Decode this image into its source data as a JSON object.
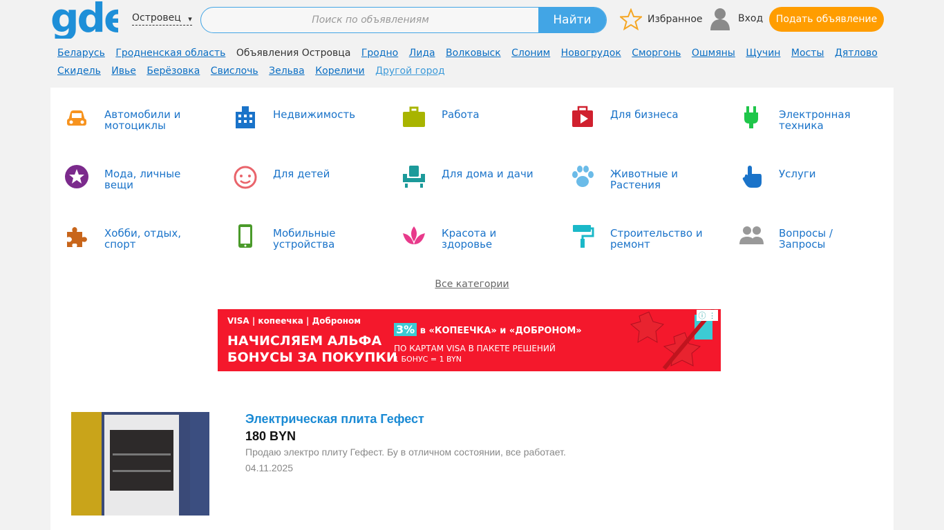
{
  "header": {
    "logo_text": "gde",
    "city": "Островец",
    "search_placeholder": "Поиск по объявлениям",
    "search_button": "Найти",
    "favorites": "Избранное",
    "login": "Вход",
    "post_ad": "Подать объявление"
  },
  "cities": [
    {
      "label": "Беларусь",
      "kind": "link"
    },
    {
      "label": "Гродненская область",
      "kind": "link"
    },
    {
      "label": "Объявления Островца",
      "kind": "current"
    },
    {
      "label": "Гродно",
      "kind": "link"
    },
    {
      "label": "Лида",
      "kind": "link"
    },
    {
      "label": "Волковыск",
      "kind": "link"
    },
    {
      "label": "Слоним",
      "kind": "link"
    },
    {
      "label": "Новогрудок",
      "kind": "link"
    },
    {
      "label": "Сморгонь",
      "kind": "link"
    },
    {
      "label": "Ошмяны",
      "kind": "link"
    },
    {
      "label": "Щучин",
      "kind": "link"
    },
    {
      "label": "Мосты",
      "kind": "link"
    },
    {
      "label": "Дятлово",
      "kind": "link"
    },
    {
      "label": "Скидель",
      "kind": "link"
    },
    {
      "label": "Ивье",
      "kind": "link"
    },
    {
      "label": "Берёзовка",
      "kind": "link"
    },
    {
      "label": "Свислочь",
      "kind": "link"
    },
    {
      "label": "Зельва",
      "kind": "link"
    },
    {
      "label": "Кореличи",
      "kind": "link"
    },
    {
      "label": "Другой город",
      "kind": "other"
    }
  ],
  "categories": [
    {
      "label": "Автомобили и мотоциклы",
      "icon": "car-icon",
      "color": "#f7931e"
    },
    {
      "label": "Недвижимость",
      "icon": "building-icon",
      "color": "#1a73c9"
    },
    {
      "label": "Работа",
      "icon": "briefcase-icon",
      "color": "#a8b400"
    },
    {
      "label": "Для бизнеса",
      "icon": "video-play-icon",
      "color": "#d0202e"
    },
    {
      "label": "Электронная техника",
      "icon": "plug-icon",
      "color": "#1fc64a"
    },
    {
      "label": "Мода, личные вещи",
      "icon": "star-badge-icon",
      "color": "#7b2a8c"
    },
    {
      "label": "Для детей",
      "icon": "baby-face-icon",
      "color": "#e9646b"
    },
    {
      "label": "Для дома и дачи",
      "icon": "armchair-icon",
      "color": "#1c9a9a"
    },
    {
      "label": "Животные и Растения",
      "icon": "paw-icon",
      "color": "#6bbbe8"
    },
    {
      "label": "Услуги",
      "icon": "hand-pointer-icon",
      "color": "#1a73c9"
    },
    {
      "label": "Хобби, отдых, спорт",
      "icon": "puzzle-icon",
      "color": "#c8651a"
    },
    {
      "label": "Мобильные устройства",
      "icon": "smartphone-icon",
      "color": "#4a9a2a"
    },
    {
      "label": "Красота и здоровье",
      "icon": "lotus-icon",
      "color": "#e83a8b"
    },
    {
      "label": "Строительство и ремонт",
      "icon": "paint-roller-icon",
      "color": "#1ab8c8"
    },
    {
      "label": "Вопросы / Запросы",
      "icon": "people-icon",
      "color": "#999999"
    }
  ],
  "all_categories": "Все категории",
  "ad": {
    "brands": "VISA | копеечка | Доброном",
    "headline": "НАЧИСЛЯЕМ АЛЬФА БОНУСЫ ЗА ПОКУПКИ",
    "promo_pct": "3%",
    "promo_text": "в «КОПЕЕЧКА» и «ДОБРОНОМ»",
    "sub1": "ПО КАРТАМ VISA В ПАКЕТЕ РЕШЕНИЙ",
    "sub2": "1 БОНУС = 1 BYN"
  },
  "listing": {
    "title": "Электрическая плита Гефест",
    "price": "180 BYN",
    "description": "Продаю электро плиту Гефест. Бу в отличном состоянии, все работает.",
    "date": "04.11.2025"
  }
}
